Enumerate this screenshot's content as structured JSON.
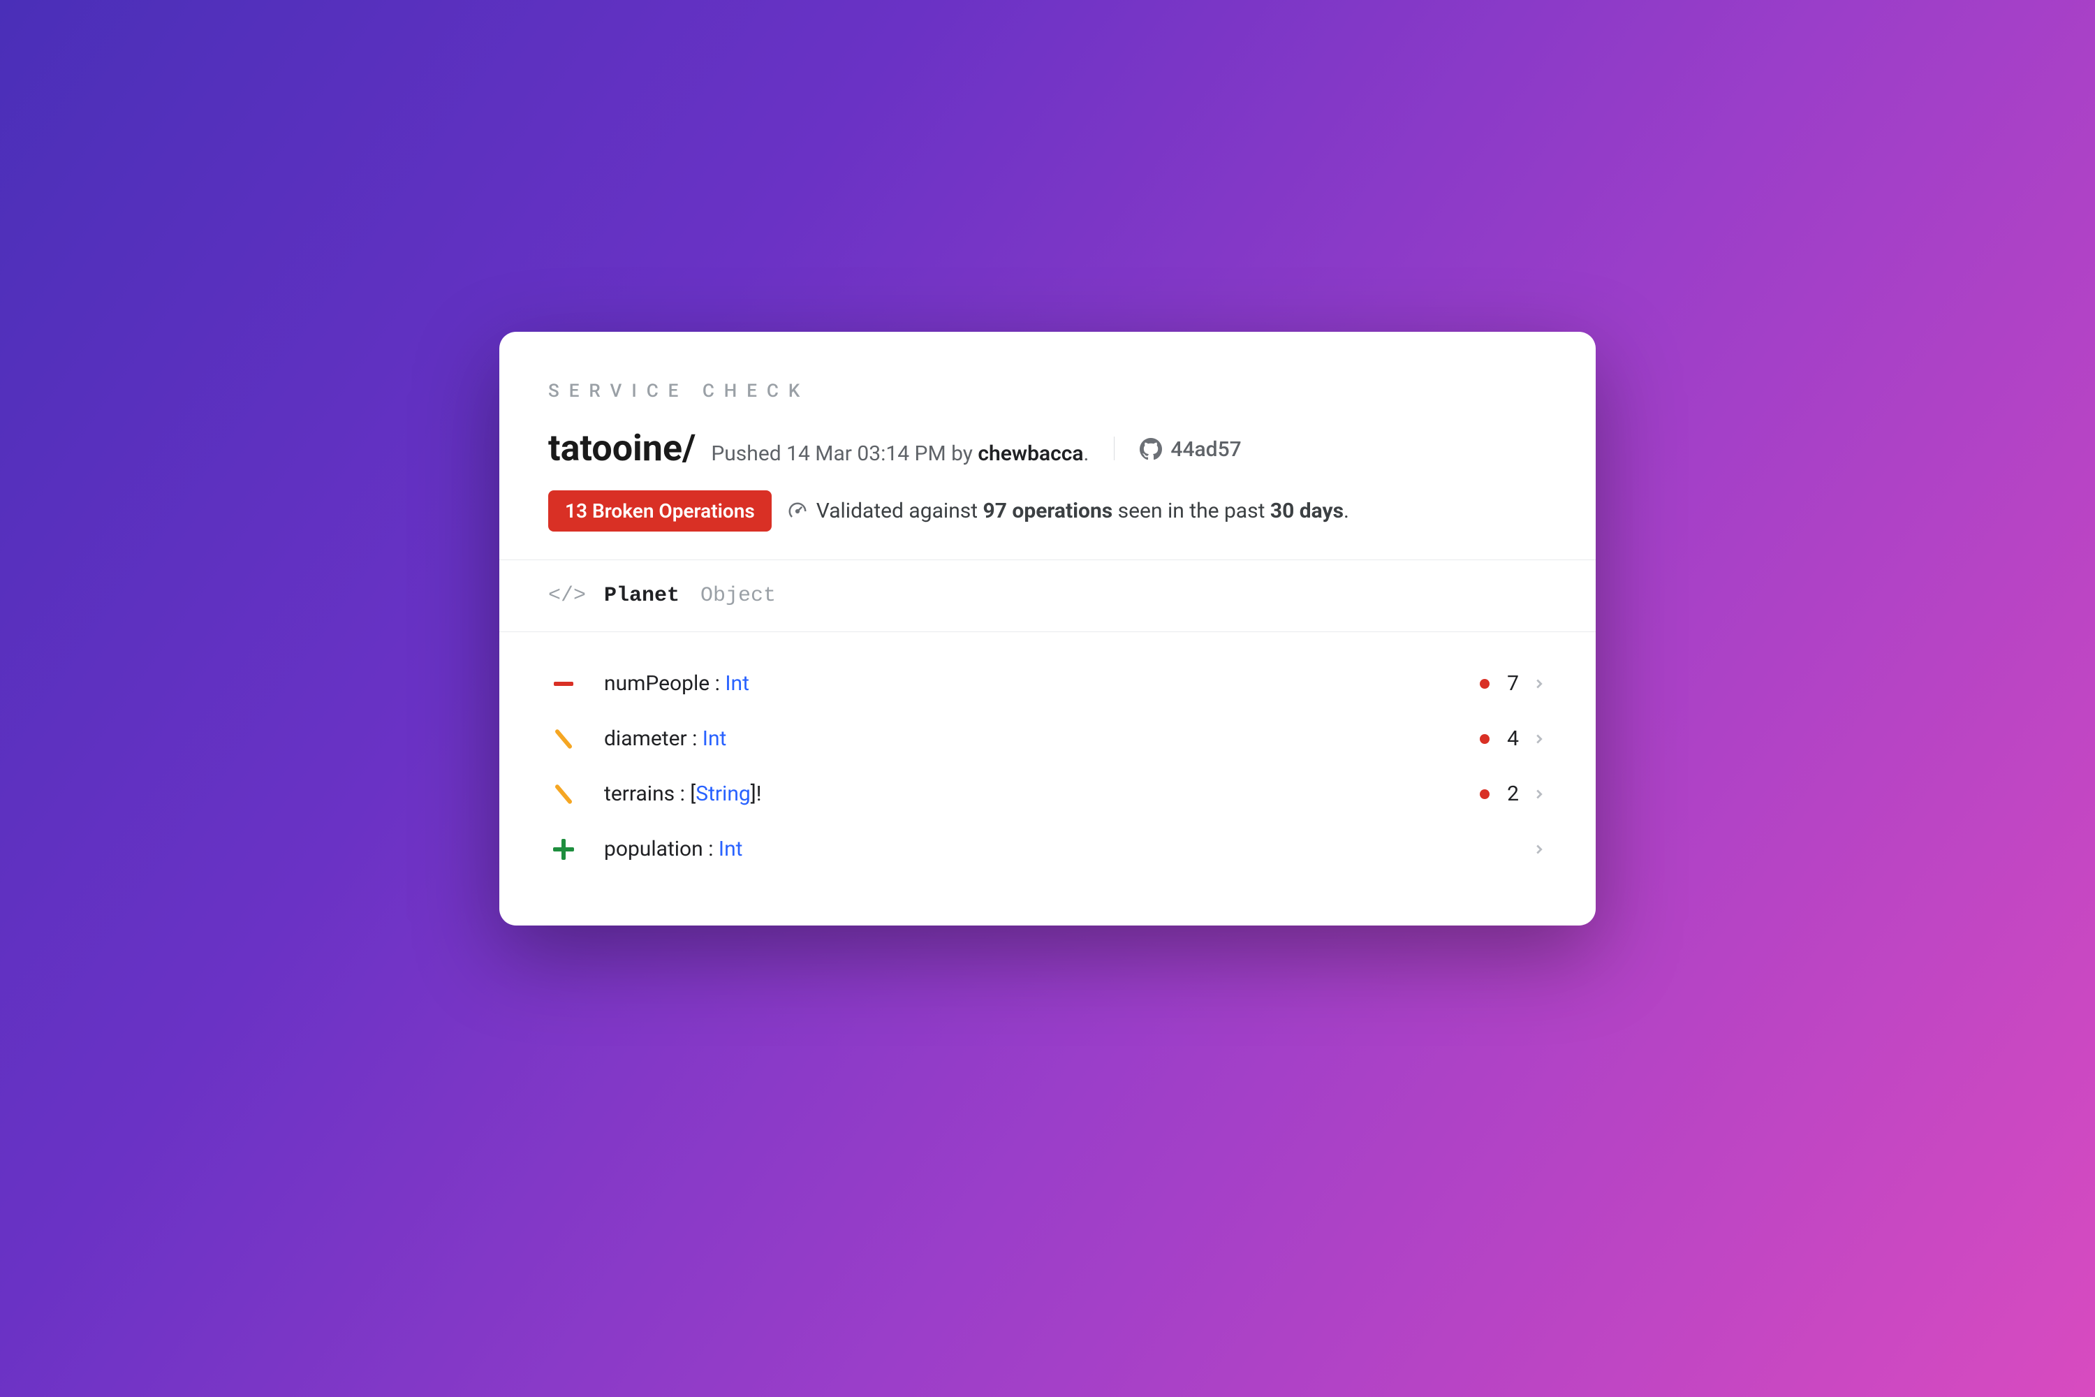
{
  "eyebrow": "SERVICE CHECK",
  "header": {
    "service_name": "tatooine/",
    "pushed_prefix": "Pushed ",
    "pushed_time": "14 Mar 03:14 PM",
    "by_word": " by ",
    "author": "chewbacca",
    "period": ".",
    "commit_sha": "44ad57"
  },
  "status": {
    "badge": "13 Broken Operations",
    "validated_prefix": "Validated against ",
    "op_count": "97 operations",
    "middle": " seen in the past ",
    "window": "30 days",
    "suffix": "."
  },
  "type": {
    "icon": "</>",
    "name": "Planet",
    "kind": "Object"
  },
  "fields": [
    {
      "change": "removed",
      "name": "numPeople",
      "sep": " : ",
      "type": "Int",
      "impacts": 7
    },
    {
      "change": "modified",
      "name": "diameter",
      "sep": " : ",
      "type": "Int",
      "impacts": 4
    },
    {
      "change": "modified",
      "name": "terrains",
      "sep": " : ",
      "type_prefix": "[",
      "type": "String",
      "type_suffix": "]!",
      "impacts": 2
    },
    {
      "change": "added",
      "name": "population",
      "sep": " : ",
      "type": "Int"
    }
  ]
}
